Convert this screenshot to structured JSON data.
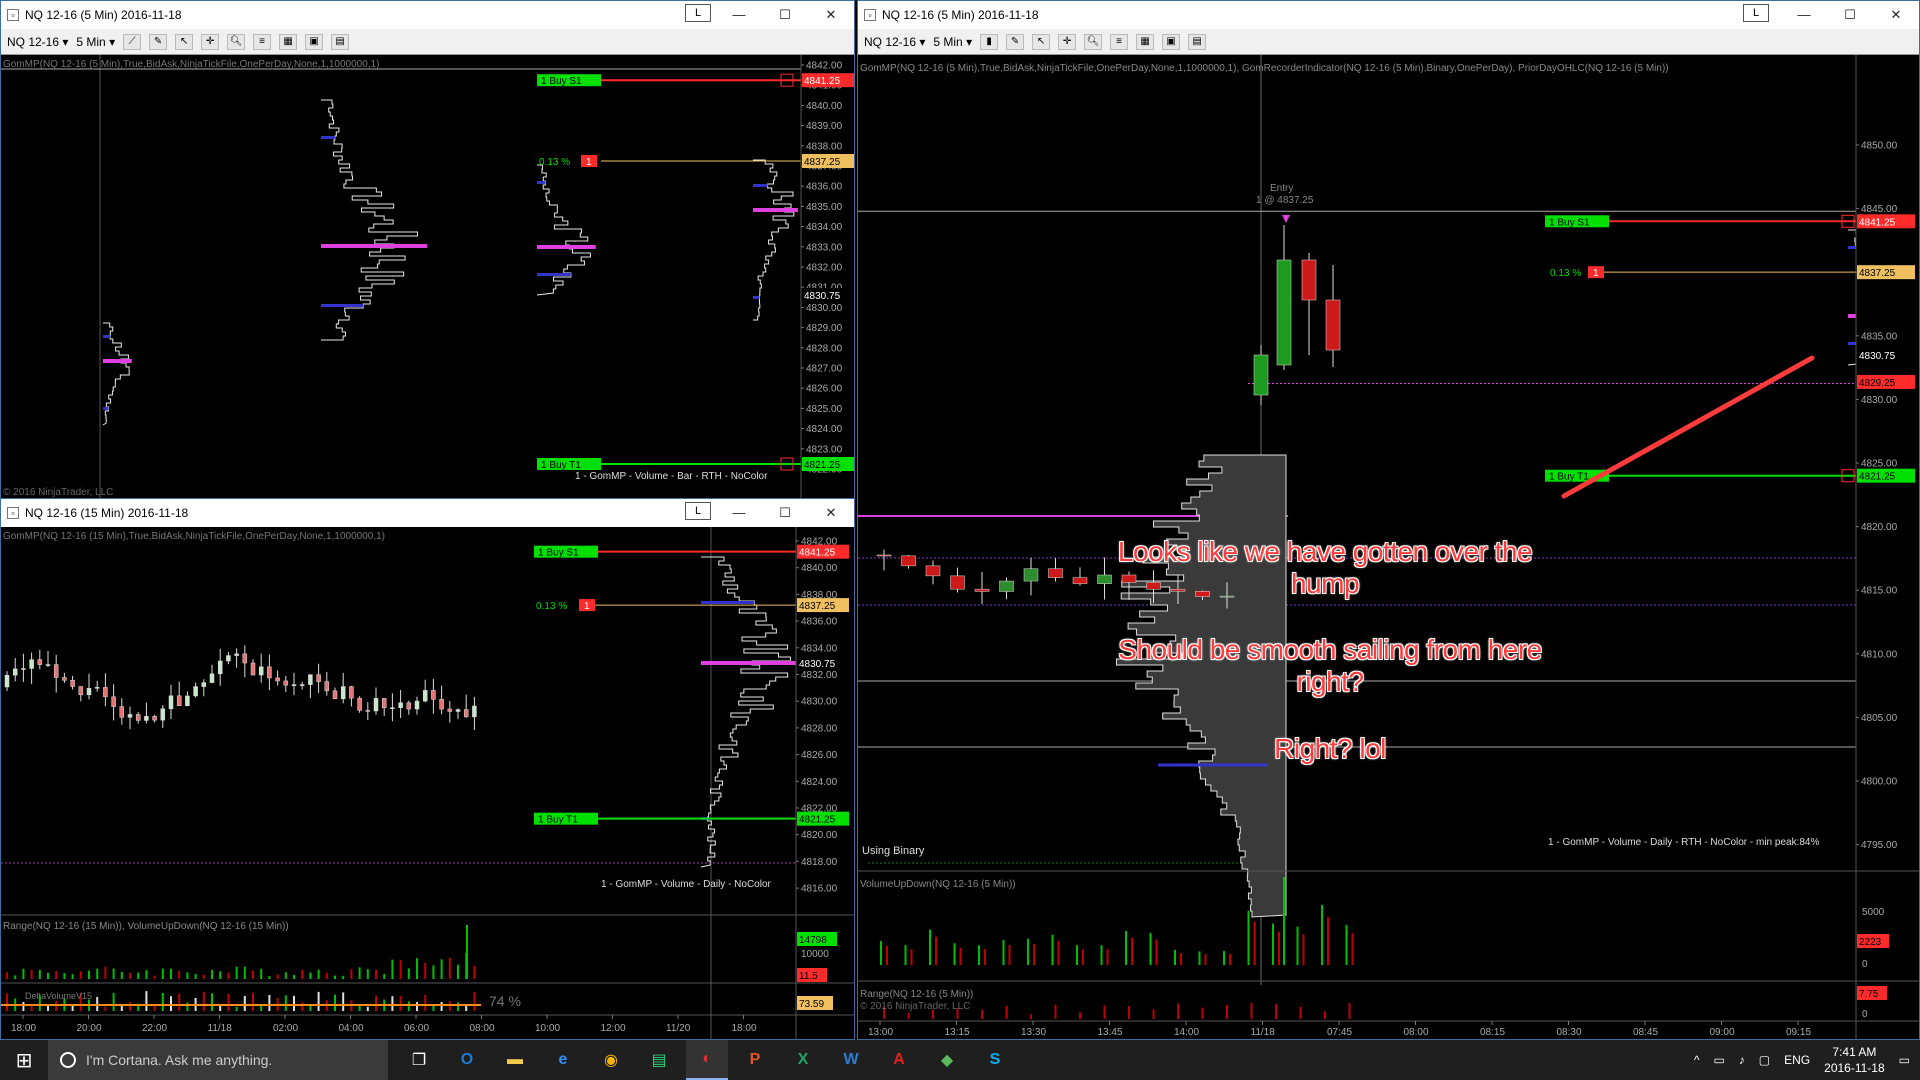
{
  "colors": {
    "accent_red": "#ff2a2a",
    "green": "#00e000",
    "magenta": "#e040e0",
    "gold": "#f0c060",
    "profile_fill": "#3a3a3a"
  },
  "win_tl": {
    "title": "NQ 12-16 (5 Min)  2016-11-18",
    "symbol_btn": "NQ 12-16",
    "interval_btn": "5 Min",
    "indicator_header": "GomMP(NQ 12-16 (5 Min),True,BidAsk,NinjaTickFile,OnePerDay,None,1,1000000,1)",
    "footer": "1 - GomMP - Volume - Bar - RTH - NoColor",
    "copyright": "© 2016 NinjaTrader, LLC",
    "prices": [
      "4842.00",
      "4841.00",
      "4840.00",
      "4839.00",
      "4838.00",
      "4837.00",
      "4836.00",
      "4835.00",
      "4834.00",
      "4833.00",
      "4832.00",
      "4831.00",
      "4830.00",
      "4829.00",
      "4828.00",
      "4827.00",
      "4826.00",
      "4825.00",
      "4824.00",
      "4823.00",
      "4822.00"
    ],
    "tags": {
      "s1_val": "4841.25",
      "t1_val": "4821.25",
      "entry_val": "4837.25",
      "last_val": "4830.75"
    }
  },
  "win_bl": {
    "title": "NQ 12-16 (15 Min)  2016-11-18",
    "indicator_header": "GomMP(NQ 12-16 (15 Min),True,BidAsk,NinjaTickFile,OnePerDay,None,1,1000000,1)",
    "footer": "1 - GomMP - Volume - Daily - NoColor",
    "sub1_header": "Range(NQ 12-16 (15 Min)), VolumeUpDown(NQ 12-16 (15 Min))",
    "sub2_header": "DeltaVolumeV15",
    "pct": "74 %",
    "prices": [
      "4842.00",
      "4840.00",
      "4838.00",
      "4836.00",
      "4834.00",
      "4832.00",
      "4830.00",
      "4828.00",
      "4826.00",
      "4824.00",
      "4822.00",
      "4820.00",
      "4818.00",
      "4816.00"
    ],
    "sub1_vals": {
      "v1": "14798",
      "v2": "10000",
      "v3": "11.5"
    },
    "sub2_val": "73.59",
    "times": [
      "18:00",
      "20:00",
      "22:00",
      "11/18",
      "02:00",
      "04:00",
      "06:00",
      "08:00",
      "10:00",
      "12:00",
      "11/20",
      "18:00"
    ],
    "tags": {
      "s1_val": "4841.25",
      "t1_val": "4821.25",
      "entry_val": "4837.25",
      "last_val": "4830.75"
    }
  },
  "win_r": {
    "title": "NQ 12-16 (5 Min)  2016-11-18",
    "symbol_btn": "NQ 12-16",
    "interval_btn": "5 Min",
    "indicator_header": "GomMP(NQ 12-16 (5 Min),True,BidAsk,NinjaTickFile,OnePerDay,None,1,1000000,1), GomRecorderIndicator(NQ 12-16 (5 Min),Binary,OnePerDay), PriorDayOHLC(NQ 12-16 (5 Min))",
    "footer": "1 - GomMP - Volume - Daily - RTH - NoColor - min peak:84%",
    "using": "Using Binary",
    "entry_label": "Entry",
    "entry_detail": "1 @ 4837.25",
    "sub1_header": "VolumeUpDown(NQ 12-16 (5 Min))",
    "sub2_header": "Range(NQ 12-16 (5 Min))",
    "copyright": "© 2016 NinjaTrader, LLC",
    "prices": [
      "4850.00",
      "4845.00",
      "4840.00",
      "4835.00",
      "4830.00",
      "4825.00",
      "4820.00",
      "4815.00",
      "4810.00",
      "4805.00",
      "4800.00",
      "4795.00"
    ],
    "sub1_vals": {
      "v1": "5000",
      "v2": "2223",
      "v3": "0"
    },
    "sub2_vals": {
      "v1": "7.75",
      "v2": "0"
    },
    "times": [
      "13:00",
      "13:15",
      "13:30",
      "13:45",
      "14:00",
      "11/18",
      "07:45",
      "08:00",
      "08:15",
      "08:30",
      "08:45",
      "09:00",
      "09:15"
    ],
    "tags": {
      "s1_val": "4841.25",
      "t1_val": "4821.25",
      "entry_val": "4837.25",
      "last_val": "4830.75",
      "bid_val": "4829.25"
    }
  },
  "orders": {
    "s1": "1  Buy S1",
    "t1": "1  Buy T1",
    "pct": "0.13 %",
    "qty": "1"
  },
  "annotation": {
    "line1": "Looks like we have gotten over the hump",
    "line2": "Should be smooth sailing from here right?",
    "line3": "Right? lol"
  },
  "taskbar": {
    "search": "I'm Cortana. Ask me anything.",
    "time": "7:41 AM",
    "date": "2016-11-18",
    "lang": "ENG",
    "apps": [
      "task-view",
      "outlook",
      "file-explorer",
      "edge",
      "chrome",
      "tws",
      "ninjatrader",
      "powerpoint",
      "excel",
      "word",
      "acrobat",
      "camtasia",
      "skype"
    ]
  }
}
